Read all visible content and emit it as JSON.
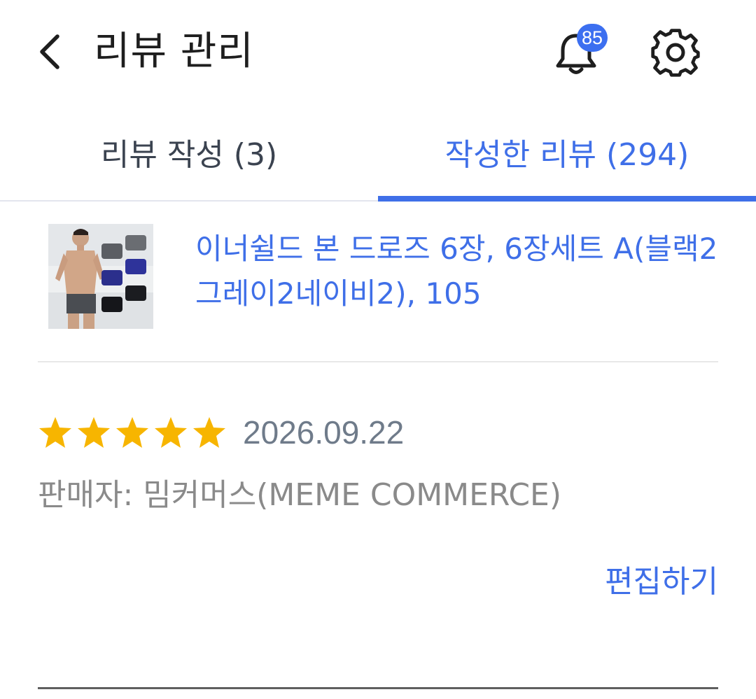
{
  "header": {
    "title": "리뷰 관리",
    "notification_count": "85",
    "accent_color": "#3c6ff0"
  },
  "tabs": [
    {
      "label": "리뷰 작성 (3)",
      "active": false
    },
    {
      "label": "작성한 리뷰 (294)",
      "active": true
    }
  ],
  "review": {
    "product": {
      "name": "이너쉴드 본 드로즈 6장, 6장세트 A(블랙2그레이2네이비2), 105",
      "thumbnail_icon": "product-thumbnail"
    },
    "rating": 5,
    "rating_max": 5,
    "date": "2026.09.22",
    "seller": "판매자: 밈커머스(MEME COMMERCE)",
    "edit_label": "편집하기"
  },
  "colors": {
    "link_blue": "#3f6fe8",
    "star_yellow": "#f7b500",
    "date_gray": "#6f7b8a",
    "seller_gray": "#8a8a8a"
  },
  "icons": {
    "back": "back-arrow-icon",
    "notifications": "bell-icon",
    "settings": "gear-icon",
    "rating": "star-icon"
  }
}
